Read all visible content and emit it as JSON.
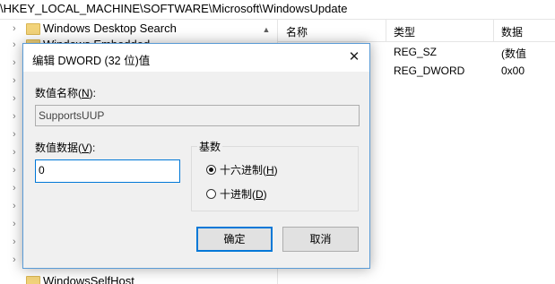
{
  "address_bar": {
    "path": "\\HKEY_LOCAL_MACHINE\\SOFTWARE\\Microsoft\\WindowsUpdate"
  },
  "tree": {
    "top_item": "Windows Desktop Search",
    "partial_item": "Windows Embedded...",
    "bottom_item": "WindowsSelfHost"
  },
  "list": {
    "columns": [
      "名称",
      "类型",
      "数据"
    ],
    "rows": [
      {
        "type": "REG_SZ",
        "data": "(数值"
      },
      {
        "type": "REG_DWORD",
        "data": "0x00"
      }
    ]
  },
  "dialog": {
    "title": "编辑 DWORD (32 位)值",
    "value_name_label_prefix": "数值名称(",
    "value_name_label_key": "N",
    "value_name_label_suffix": "):",
    "value_name": "SupportsUUP",
    "value_data_label_prefix": "数值数据(",
    "value_data_label_key": "V",
    "value_data_label_suffix": "):",
    "value_data": "0",
    "base_group_title": "基数",
    "radio_hex_prefix": "十六进制(",
    "radio_hex_key": "H",
    "radio_hex_suffix": ")",
    "radio_dec_prefix": "十进制(",
    "radio_dec_key": "D",
    "radio_dec_suffix": ")",
    "selected_base": "hex",
    "ok_label": "确定",
    "cancel_label": "取消"
  }
}
